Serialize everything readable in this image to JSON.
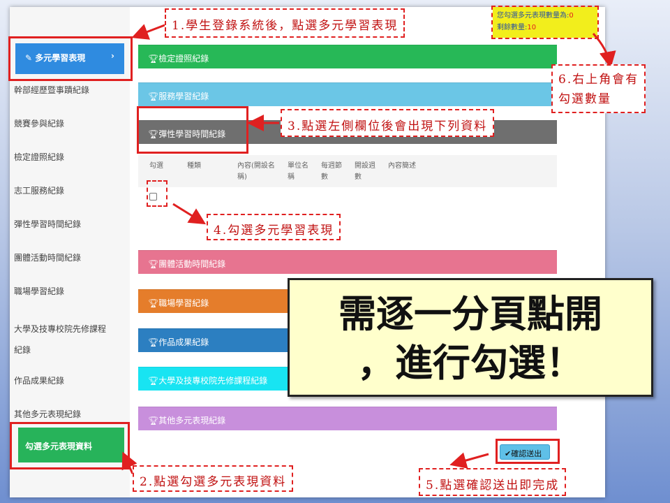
{
  "sidebar": {
    "active_item": "多元學習表現",
    "items": [
      "幹部經歷暨事蹟紀錄",
      "競賽參與紀錄",
      "檢定證照紀錄",
      "志工服務紀錄",
      "彈性學習時間紀錄",
      "團體活動時間紀錄",
      "職場學習紀錄",
      "大學及技專校院先修課程紀錄",
      "作品成果紀錄",
      "其他多元表現紀錄"
    ],
    "bottom_button": "勾選多元表現資料"
  },
  "panels": {
    "p1": "檢定證照紀錄",
    "p2": "服務學習紀錄",
    "p3": "彈性學習時間紀錄",
    "p4": "團體活動時間紀錄",
    "p5": "職場學習紀錄",
    "p6": "作品成果紀錄",
    "p7": "大學及技專校院先修課程紀錄",
    "p8": "其他多元表現紀錄"
  },
  "table": {
    "headers": [
      "勾選",
      "種類",
      "內容(開設名稱)",
      "單位名稱",
      "每週節數",
      "開設週數",
      "內容簡述"
    ]
  },
  "counter": {
    "line1_label": "您勾選多元表現數量為:",
    "line1_value": "0",
    "line2_label": "剩餘數量:",
    "line2_value": "10"
  },
  "confirm_button": "確認送出",
  "callouts": {
    "c1": "1.學生登錄系統後，點選多元學習表現",
    "c2": "2.點選勾選多元表現資料",
    "c3": "3.點選左側欄位後會出現下列資料",
    "c4": "4.勾選多元學習表現",
    "c5": "5.點選確認送出即完成",
    "c6a": "6.右上角會有",
    "c6b": "勾選數量"
  },
  "notice": {
    "line1": "需逐一分頁點開",
    "line2": "，進行勾選！"
  },
  "colors": {
    "panel_green": "#27b857",
    "panel_lightblue": "#6bc6e6",
    "panel_gray": "#6f6f6f",
    "panel_pink": "#e77490",
    "panel_orange": "#e57d2b",
    "panel_blue": "#2c7fc1",
    "panel_cyan": "#18e4f2",
    "panel_purple": "#c88fdc",
    "annotation_red": "#e02020",
    "notice_bg": "#ffffcc"
  }
}
